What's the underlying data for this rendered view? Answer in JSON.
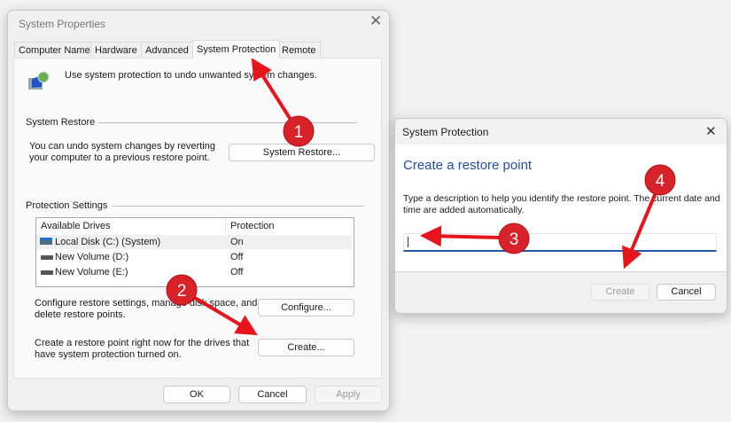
{
  "system_properties": {
    "title": "System Properties",
    "tabs": [
      "Computer Name",
      "Hardware",
      "Advanced",
      "System Protection",
      "Remote"
    ],
    "intro": "Use system protection to undo unwanted system changes.",
    "system_restore": {
      "label": "System Restore",
      "text1": "You can undo system changes by reverting",
      "text2": "your computer to a previous restore point.",
      "button": "System Restore..."
    },
    "protection_settings": {
      "label": "Protection Settings",
      "columns": [
        "Available Drives",
        "Protection"
      ],
      "drives": [
        {
          "name": "Local Disk (C:) (System)",
          "protection": "On"
        },
        {
          "name": "New Volume (D:)",
          "protection": "Off"
        },
        {
          "name": "New Volume (E:)",
          "protection": "Off"
        }
      ],
      "configure_text1": "Configure restore settings, manage disk space, and",
      "configure_text2": "delete restore points.",
      "configure_button": "Configure...",
      "create_text1": "Create a restore point right now for the drives that",
      "create_text2": "have system protection turned on.",
      "create_button": "Create..."
    },
    "buttons": {
      "ok": "OK",
      "cancel": "Cancel",
      "apply": "Apply"
    }
  },
  "create_dialog": {
    "title": "System Protection",
    "heading": "Create a restore point",
    "desc1": "Type a description to help you identify the restore point. The current date and",
    "desc2": "time are added automatically.",
    "input_value": "",
    "create": "Create",
    "cancel": "Cancel"
  },
  "annotations": [
    "1",
    "2",
    "3",
    "4"
  ],
  "colors": {
    "accent": "#1f4fa8",
    "arrow": "#e8141b"
  }
}
